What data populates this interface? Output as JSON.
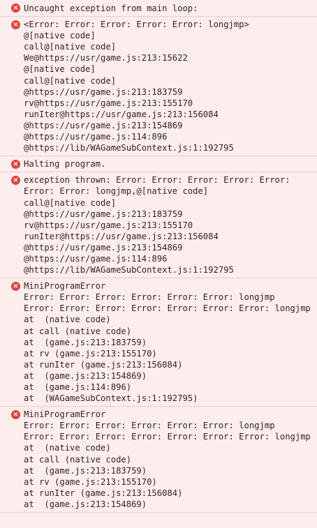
{
  "console": {
    "entries": [
      {
        "icon": "error-icon",
        "lines": [
          "Uncaught exception from main loop:"
        ]
      },
      {
        "icon": "error-icon",
        "lines": [
          "<Error: Error: Error: Error: Error: longjmp>",
          "@[native code]",
          "call@[native code]",
          "We@https://usr/game.js:213:15622",
          "@[native code]",
          "call@[native code]",
          "@https://usr/game.js:213:183759",
          "rv@https://usr/game.js:213:155170",
          "runIter@https://usr/game.js:213:156084",
          "@https://usr/game.js:213:154869",
          "@https://usr/game.js:114:896",
          "@https://lib/WAGameSubContext.js:1:192795"
        ]
      },
      {
        "icon": "error-icon",
        "lines": [
          "Halting program."
        ]
      },
      {
        "icon": "error-icon",
        "lines": [
          "exception thrown: Error: Error: Error: Error: Error: Error: Error: longjmp,@[native code]",
          "call@[native code]",
          "@https://usr/game.js:213:183759",
          "rv@https://usr/game.js:213:155170",
          "runIter@https://usr/game.js:213:156084",
          "@https://usr/game.js:213:154869",
          "@https://usr/game.js:114:896",
          "@https://lib/WAGameSubContext.js:1:192795"
        ]
      },
      {
        "icon": "error-icon",
        "lines": [
          "MiniProgramError",
          "Error: Error: Error: Error: Error: Error: longjmp",
          "Error: Error: Error: Error: Error: Error: Error: longjmp",
          "at  (native code)",
          "at call (native code)",
          "at  (game.js:213:183759)",
          "at rv (game.js:213:155170)",
          "at runIter (game.js:213:156084)",
          "at  (game.js:213:154869)",
          "at  (game.js:114:896)",
          "at  (WAGameSubContext.js:1:192795)"
        ]
      },
      {
        "icon": "error-icon",
        "lines": [
          "MiniProgramError",
          "Error: Error: Error: Error: Error: Error: longjmp",
          "Error: Error: Error: Error: Error: Error: Error: longjmp",
          "at  (native code)",
          "at call (native code)",
          "at  (game.js:213:183759)",
          "at rv (game.js:213:155170)",
          "at runIter (game.js:213:156084)",
          "at  (game.js:213:154869)"
        ]
      }
    ],
    "icon_glyph": "×",
    "colors": {
      "background": "#fdeeee",
      "border": "#f2c8c8",
      "icon": "#e0433d",
      "text": "#3b1c1c"
    }
  }
}
